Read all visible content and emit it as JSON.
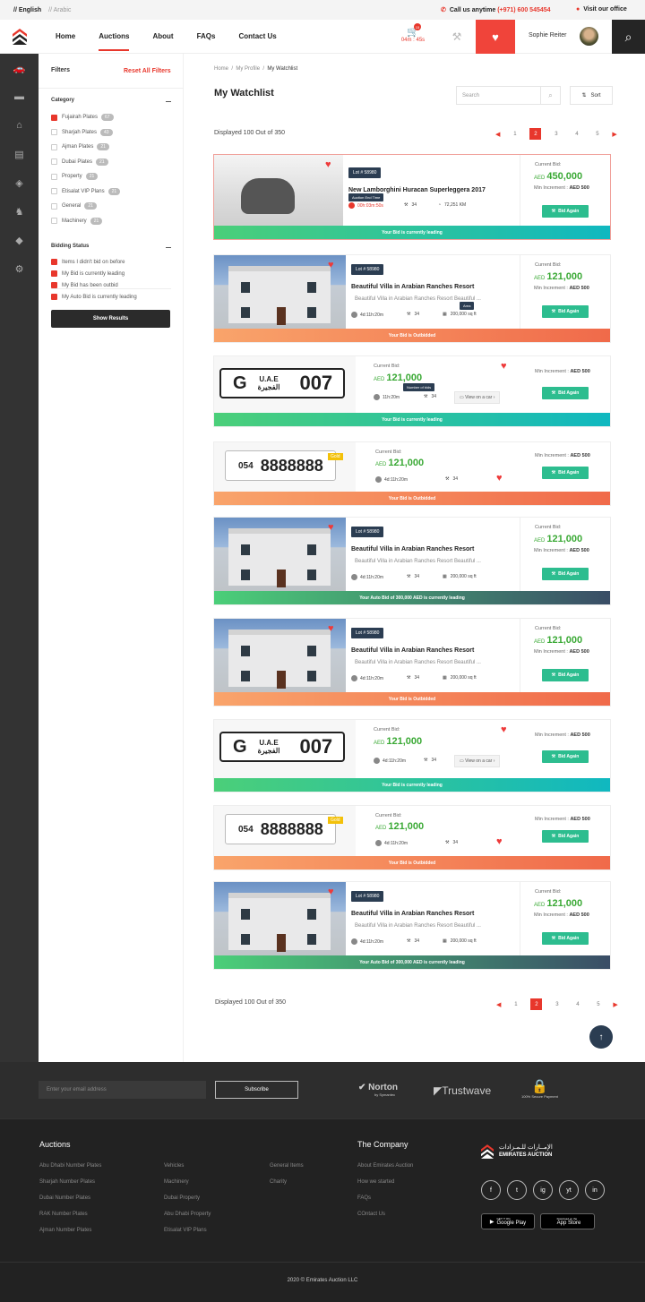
{
  "topbar": {
    "lang_en": "// English",
    "lang_ar": "// Arabic",
    "call_label": "Call us anytime",
    "phone": "(+971) 600 545454",
    "office": "Visit our office"
  },
  "header": {
    "nav": [
      "Home",
      "Auctions",
      "About",
      "FAQs",
      "Contact Us"
    ],
    "active_nav": "Auctions",
    "cart_count": "15",
    "timer": "04m : 45s",
    "user_name": "Sophie Reiter"
  },
  "filters": {
    "title": "Filters",
    "reset": "Reset All Filters",
    "category_title": "Category",
    "categories": [
      {
        "label": "Fujairah Plates",
        "count": "67",
        "checked": true
      },
      {
        "label": "Sharjah Plates",
        "count": "43",
        "checked": false
      },
      {
        "label": "Ajman Plates",
        "count": "21",
        "checked": false
      },
      {
        "label": "Dubai Plates",
        "count": "21",
        "checked": false
      },
      {
        "label": "Property",
        "count": "21",
        "checked": false
      },
      {
        "label": "Etisalat VIP Plans",
        "count": "21",
        "checked": false
      },
      {
        "label": "General",
        "count": "21",
        "checked": false
      },
      {
        "label": "Machinery",
        "count": "21",
        "checked": false
      }
    ],
    "status_title": "Bidding Status",
    "statuses": [
      {
        "label": "Items I didn't bid on before",
        "checked": true
      },
      {
        "label": "My Bid is currently leading",
        "checked": true
      },
      {
        "label": "My Bid has been outbid",
        "checked": true
      },
      {
        "label": "My Auto Bid is currently leading",
        "checked": true
      }
    ],
    "show_results": "Show Results"
  },
  "main": {
    "breadcrumb": [
      "Home",
      "My Profile",
      "My Watchlist"
    ],
    "title": "My Watchlist",
    "search_placeholder": "Search",
    "sort": "Sort",
    "displayed": "Displayed 100 Out of 350",
    "pages": [
      "1",
      "2",
      "3",
      "4",
      "5"
    ],
    "active_page": "2"
  },
  "labels": {
    "current_bid": "Current Bid:",
    "min_increment": "Min Increment :",
    "aed": "AED",
    "bid_again": "Bid Again",
    "view_car": "View on a car",
    "tt_end": "Auction End Time",
    "tt_bids": "Number of bids",
    "tt_area": "Area"
  },
  "cards": [
    {
      "type": "car",
      "lot": "Lot # 58980",
      "title": "New Lamborghini Huracan Superleggera 2017",
      "time": "00h:03m:50s",
      "bids": "34",
      "km": "72,251 KM",
      "bid": "450,000",
      "min": "AED 500",
      "status": "Your Bid is currently leading",
      "kind": "leading"
    },
    {
      "type": "house",
      "lot": "Lot # 58980",
      "title": "Beautiful Villa in Arabian Ranches Resort",
      "desc": "Beautiful Villa in Arabian Ranches Resort Beautiful ...",
      "time": "4d:11h:20m",
      "bids": "34",
      "area": "200,000 sq ft",
      "bid": "121,000",
      "min": "AED 500",
      "status": "Your Bid is Outbidded",
      "kind": "outbid"
    },
    {
      "type": "plate",
      "plate_code": "G",
      "plate_em": "U.A.E",
      "plate_city": "الفجيرة",
      "plate_num": "007",
      "bid": "121,000",
      "time": "11h:20m",
      "bids": "34",
      "min": "AED 500",
      "status": "Your Bid is currently leading",
      "kind": "leading"
    },
    {
      "type": "mobile",
      "prefix": "054",
      "number": "8888888",
      "tag": "Gold",
      "bid": "121,000",
      "time": "4d:11h:20m",
      "bids": "34",
      "min": "AED 500",
      "status": "Your Bid is Outbidded",
      "kind": "outbid"
    },
    {
      "type": "house",
      "lot": "Lot # 58980",
      "title": "Beautiful Villa in Arabian Ranches Resort",
      "desc": "Beautiful Villa in Arabian Ranches Resort Beautiful ...",
      "time": "4d:11h:20m",
      "bids": "34",
      "area": "200,000 sq ft",
      "bid": "121,000",
      "min": "AED 500",
      "status": "Your Auto Bid of 300,000 AED is currently leading",
      "kind": "auto"
    },
    {
      "type": "house",
      "lot": "Lot # 58980",
      "title": "Beautiful Villa in Arabian Ranches Resort",
      "desc": "Beautiful Villa in Arabian Ranches Resort Beautiful ...",
      "time": "4d:11h:20m",
      "bids": "34",
      "area": "200,000 sq ft",
      "bid": "121,000",
      "min": "AED 500",
      "status": "Your Bid is Outbidded",
      "kind": "outbid"
    },
    {
      "type": "plate",
      "plate_code": "G",
      "plate_em": "U.A.E",
      "plate_city": "الفجيرة",
      "plate_num": "007",
      "bid": "121,000",
      "time": "4d:11h:20m",
      "bids": "34",
      "min": "AED 500",
      "status": "Your Bid is currently leading",
      "kind": "leading"
    },
    {
      "type": "mobile",
      "prefix": "054",
      "number": "8888888",
      "tag": "Gold",
      "bid": "121,000",
      "time": "4d:11h:20m",
      "bids": "34",
      "min": "AED 500",
      "status": "Your Bid is Outbidded",
      "kind": "outbid"
    },
    {
      "type": "house",
      "lot": "Lot # 58980",
      "title": "Beautiful Villa in Arabian Ranches Resort",
      "desc": "Beautiful Villa in Arabian Ranches Resort Beautiful ...",
      "time": "4d:11h:20m",
      "bids": "34",
      "area": "200,000 sq ft",
      "bid": "121,000",
      "min": "AED 500",
      "status": "Your Auto Bid of 300,000 AED is currently leading",
      "kind": "auto"
    }
  ],
  "newsletter": {
    "placeholder": "Enter your email address",
    "subscribe": "Subscribe",
    "norton": "Norton",
    "norton_sub": "by Symantec",
    "trustwave": "Trustwave",
    "secure": "100% Secure Payment"
  },
  "footer": {
    "auctions_title": "Auctions",
    "company_title": "The Company",
    "col1": [
      "Abu Dhabi Number Plates",
      "Sharjah Number Plates",
      "Dubai Number Plates",
      "RAK Number Plates",
      "Ajman Number Plates"
    ],
    "col2": [
      "Vehicles",
      "Machinery",
      "Dubai Property",
      "Abu Dhabi Property",
      "Etisalat VIP Plans"
    ],
    "col3": [
      "General Items",
      "Charity"
    ],
    "col4": [
      "About Emirates Auction",
      "How we started",
      "FAQs",
      "COntact Us"
    ],
    "brand_ar": "الإمــارات للـمـزادات",
    "brand_en": "EMIRATES AUCTION",
    "social": [
      "f",
      "t",
      "ig",
      "yt",
      "in"
    ],
    "google_play": "Google Play",
    "google_top": "GET IT ON",
    "app_store": "App Store",
    "app_top": "Download on the",
    "copyright": "2020 © Emirates Auction LLC"
  }
}
